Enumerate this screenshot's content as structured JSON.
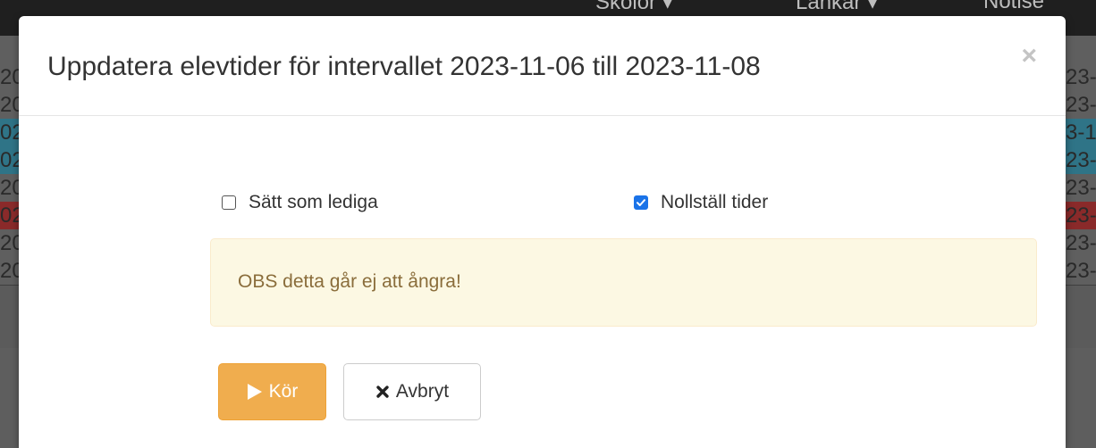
{
  "background": {
    "nav_items": [
      "Skolor ▾",
      "Länkar ▾",
      "Notise"
    ],
    "rows": [
      {
        "left": "",
        "right": "",
        "color": "#5f5f5f"
      },
      {
        "left": "20",
        "right": "23-",
        "color": "#5f5f5f"
      },
      {
        "left": "20",
        "right": "23-",
        "color": "#5f5f5f"
      },
      {
        "left": "02",
        "right": "3-1",
        "color": "#2f7487"
      },
      {
        "left": "02",
        "right": "23-",
        "color": "#2f7487"
      },
      {
        "left": "20",
        "right": "23-",
        "color": "#5f5f5f"
      },
      {
        "left": "02",
        "right": "23-",
        "color": "#8a2a2a"
      },
      {
        "left": "20",
        "right": "23-",
        "color": "#5f5f5f"
      },
      {
        "left": "20",
        "right": "23-",
        "color": "#5f5f5f"
      }
    ]
  },
  "modal": {
    "title": "Uppdatera elevtider för intervallet 2023-11-06 till 2023-11-08",
    "close_label": "×",
    "options": [
      {
        "label": "Sätt som lediga",
        "checked": false
      },
      {
        "label": "Nollställ tider",
        "checked": true
      }
    ],
    "warning": "OBS detta går ej att ångra!",
    "buttons": {
      "run_label": "Kör",
      "cancel_label": "Avbryt"
    }
  },
  "icons": {
    "run": "play-icon",
    "cancel": "times-icon",
    "checkbox_checked": "check-icon"
  },
  "colors": {
    "run_button": "#f0ad4e",
    "warning_bg": "#fcf8e3",
    "warning_text": "#8a6d3b",
    "checkbox_accent": "#1a73e8"
  }
}
